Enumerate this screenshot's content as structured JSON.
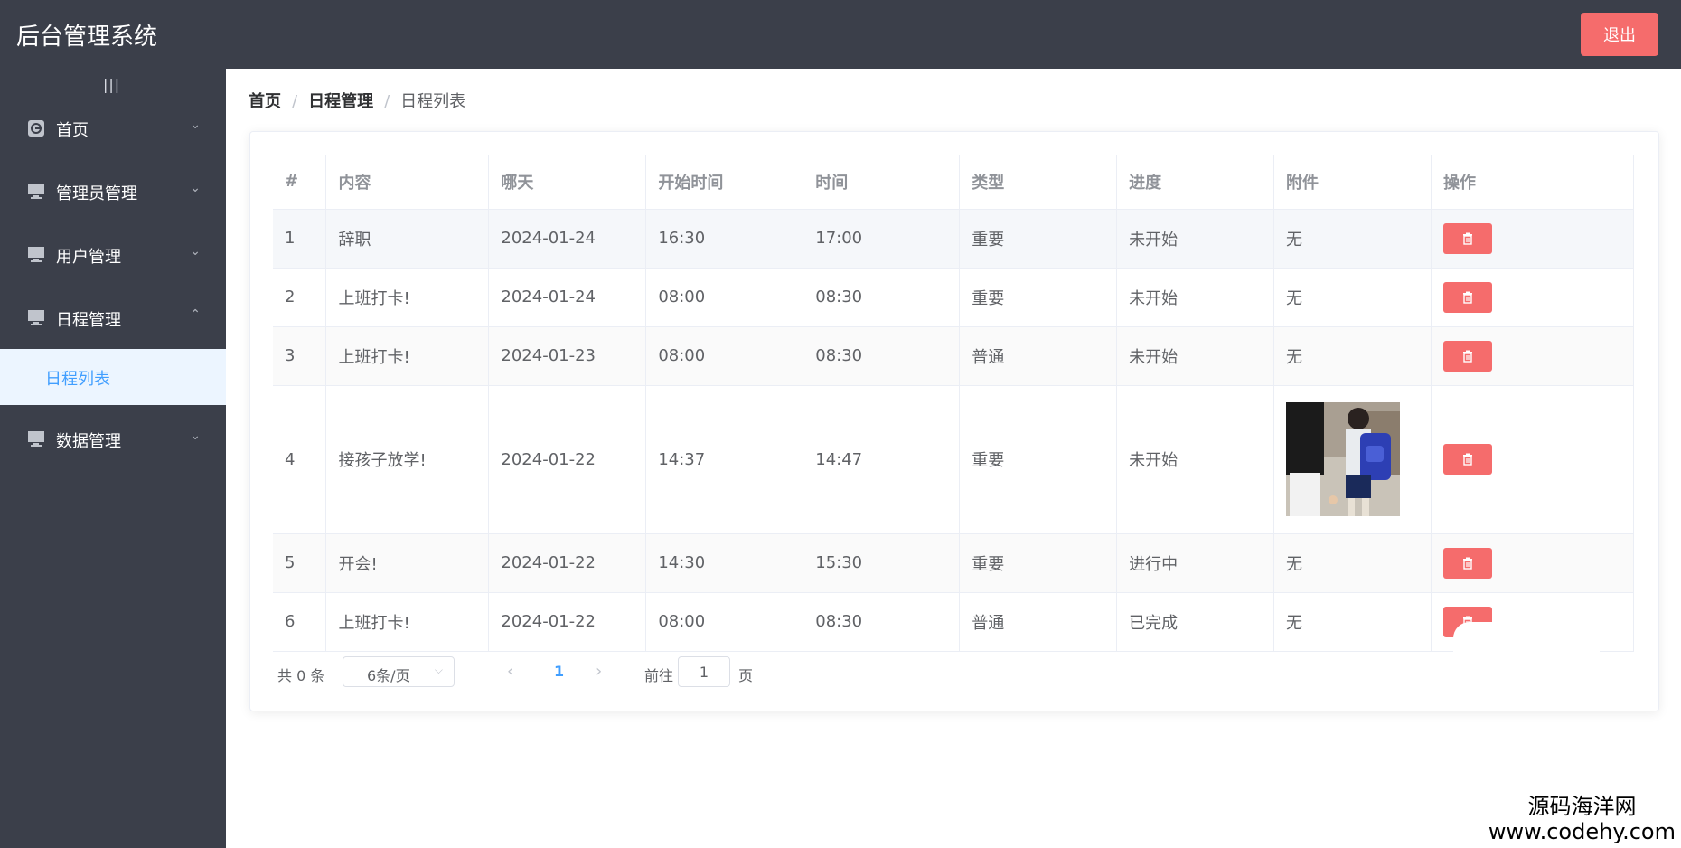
{
  "app": {
    "title": "后台管理系统",
    "logout": "退出"
  },
  "sidebar": {
    "collapse": "|||",
    "items": [
      {
        "label": "首页",
        "icon": "home-icon",
        "chevron": "⌄"
      },
      {
        "label": "管理员管理",
        "icon": "monitor-icon",
        "chevron": "⌄"
      },
      {
        "label": "用户管理",
        "icon": "monitor-icon",
        "chevron": "⌄"
      },
      {
        "label": "日程管理",
        "icon": "monitor-icon",
        "chevron": "⌃"
      },
      {
        "label": "数据管理",
        "icon": "monitor-icon",
        "chevron": "⌄"
      }
    ],
    "sub_item": "日程列表"
  },
  "breadcrumb": {
    "home": "首页",
    "section": "日程管理",
    "current": "日程列表",
    "sep": "/"
  },
  "table": {
    "headers": [
      "#",
      "内容",
      "哪天",
      "开始时间",
      "时间",
      "类型",
      "进度",
      "附件",
      "操作"
    ],
    "rows": [
      [
        "1",
        "辞职",
        "2024-01-24",
        "16:30",
        "17:00",
        "重要",
        "未开始",
        "无"
      ],
      [
        "2",
        "上班打卡!",
        "2024-01-24",
        "08:00",
        "08:30",
        "重要",
        "未开始",
        "无"
      ],
      [
        "3",
        "上班打卡!",
        "2024-01-23",
        "08:00",
        "08:30",
        "普通",
        "未开始",
        "无"
      ],
      [
        "4",
        "接孩子放学!",
        "2024-01-22",
        "14:37",
        "14:47",
        "重要",
        "未开始",
        ""
      ],
      [
        "5",
        "开会!",
        "2024-01-22",
        "14:30",
        "15:30",
        "重要",
        "进行中",
        "无"
      ],
      [
        "6",
        "上班打卡!",
        "2024-01-22",
        "08:00",
        "08:30",
        "普通",
        "已完成",
        "无"
      ]
    ]
  },
  "pagination": {
    "total": "共 0 条",
    "page_size": "6条/页",
    "prev": "‹",
    "current": "1",
    "next": "›",
    "goto": "前往",
    "goto_value": "1",
    "unit": "页"
  },
  "watermark": {
    "line1": "源码海洋网",
    "line2": "www.codehy.com"
  },
  "colors": {
    "header": "#3b3f4a",
    "danger": "#f56c6c",
    "primary": "#409eff"
  }
}
